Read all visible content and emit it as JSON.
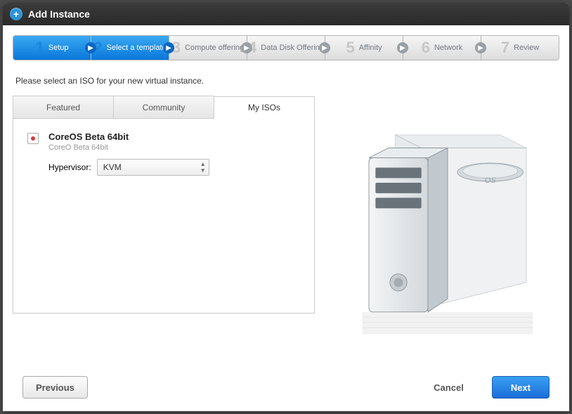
{
  "dialog": {
    "title": "Add Instance"
  },
  "wizard": {
    "steps": [
      {
        "num": "1",
        "label": "Setup"
      },
      {
        "num": "2",
        "label": "Select a template"
      },
      {
        "num": "3",
        "label": "Compute offering"
      },
      {
        "num": "4",
        "label": "Data Disk Offering"
      },
      {
        "num": "5",
        "label": "Affinity"
      },
      {
        "num": "6",
        "label": "Network"
      },
      {
        "num": "7",
        "label": "Review"
      }
    ],
    "activeIndex": 1
  },
  "instruction": "Please select an ISO for your new virtual instance.",
  "tabs": {
    "items": [
      "Featured",
      "Community",
      "My ISOs"
    ],
    "activeIndex": 2
  },
  "iso": {
    "name": "CoreOS Beta 64bit",
    "desc": "CoreO Beta 64bit",
    "hypervisor_label": "Hypervisor:",
    "hypervisor_value": "KVM",
    "selected": true
  },
  "illustration": {
    "disc_label": "OS"
  },
  "footer": {
    "previous": "Previous",
    "cancel": "Cancel",
    "next": "Next"
  }
}
